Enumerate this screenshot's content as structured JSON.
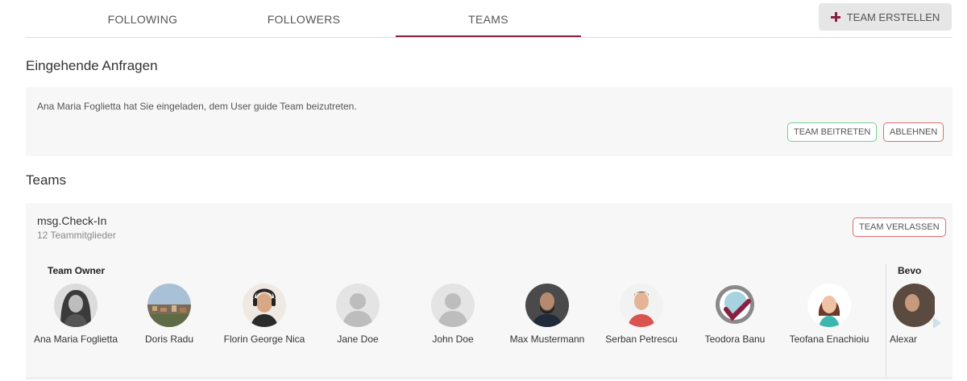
{
  "tabs": [
    {
      "label": "FOLLOWING"
    },
    {
      "label": "FOLLOWERS"
    },
    {
      "label": "TEAMS"
    }
  ],
  "create_team_label": "TEAM ERSTELLEN",
  "requests": {
    "title": "Eingehende Anfragen",
    "text": "Ana Maria Foglietta hat Sie eingeladen, dem User guide Team beizutreten.",
    "join_label": "TEAM BEITRETEN",
    "decline_label": "ABLEHNEN"
  },
  "teams": {
    "title": "Teams",
    "card": {
      "name": "msg.Check-In",
      "count": "12 Teammitglieder",
      "leave_label": "TEAM VERLASSEN",
      "owner_label": "Team Owner",
      "bevo_label": "Bevo",
      "members": [
        {
          "name": "Ana Maria Foglietta"
        },
        {
          "name": "Doris Radu"
        },
        {
          "name": "Florin George Nica"
        },
        {
          "name": "Jane Doe"
        },
        {
          "name": "John Doe"
        },
        {
          "name": "Max Mustermann"
        },
        {
          "name": "Serban Petrescu"
        },
        {
          "name": "Teodora Banu"
        },
        {
          "name": "Teofana Enachioiu"
        },
        {
          "name": "Alexar"
        }
      ]
    }
  },
  "colors": {
    "accent": "#8b1f3f",
    "join_border": "#7dcf8f",
    "decline_border": "#e06a6a"
  }
}
